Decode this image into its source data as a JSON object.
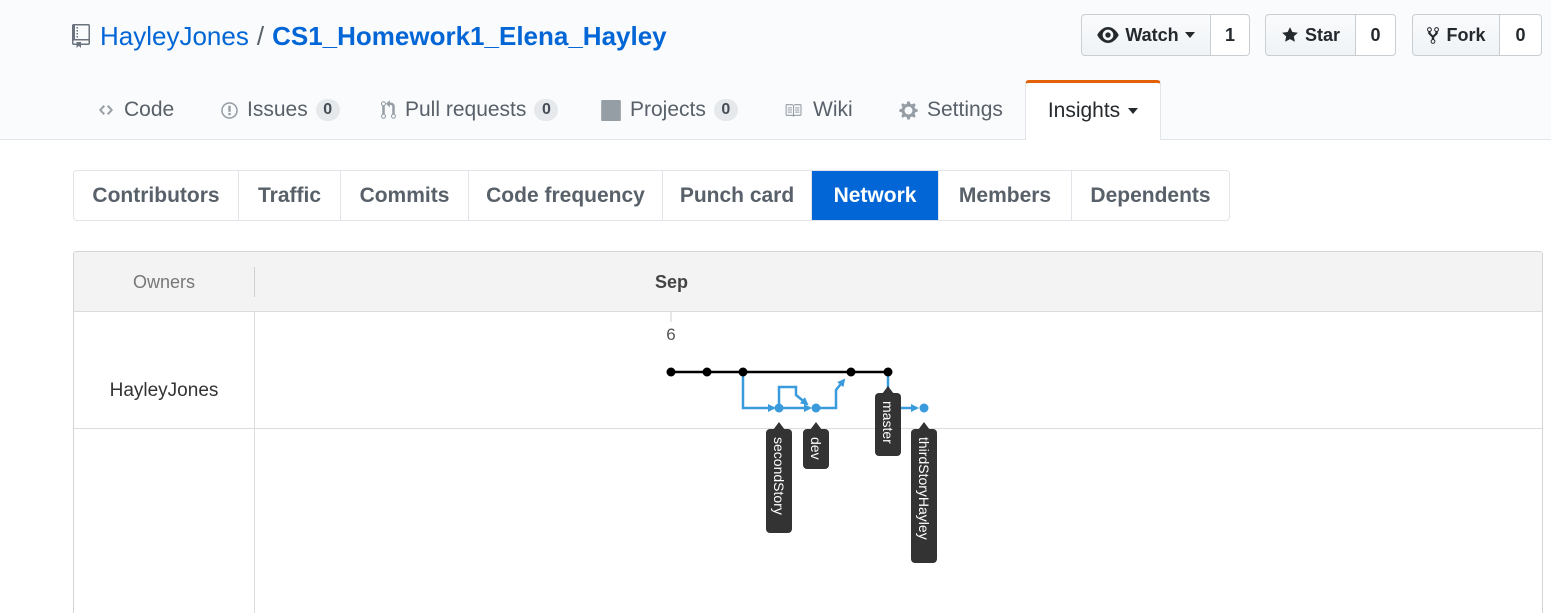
{
  "repo": {
    "owner": "HayleyJones",
    "separator": "/",
    "name": "CS1_Homework1_Elena_Hayley"
  },
  "actions": {
    "watch": {
      "label": "Watch",
      "count": "1"
    },
    "star": {
      "label": "Star",
      "count": "0"
    },
    "fork": {
      "label": "Fork",
      "count": "0"
    }
  },
  "nav": {
    "code": "Code",
    "issues": {
      "label": "Issues",
      "count": "0"
    },
    "pulls": {
      "label": "Pull requests",
      "count": "0"
    },
    "projects": {
      "label": "Projects",
      "count": "0"
    },
    "wiki": "Wiki",
    "settings": "Settings",
    "insights": "Insights"
  },
  "subnav": [
    "Contributors",
    "Traffic",
    "Commits",
    "Code frequency",
    "Punch card",
    "Network",
    "Members",
    "Dependents"
  ],
  "subnav_active": "Network",
  "network": {
    "owners_label": "Owners",
    "month": "Sep",
    "day": "6",
    "owner": "HayleyJones",
    "branches": [
      "secondStory",
      "dev",
      "master",
      "thirdStoryHayley"
    ]
  },
  "colors": {
    "link": "#0366d6",
    "active_tab": "#0366d6",
    "insights_accent": "#e36209",
    "main_branch": "#000000",
    "branch_line": "#3a9bdc",
    "branch_label_bg": "#333333"
  }
}
